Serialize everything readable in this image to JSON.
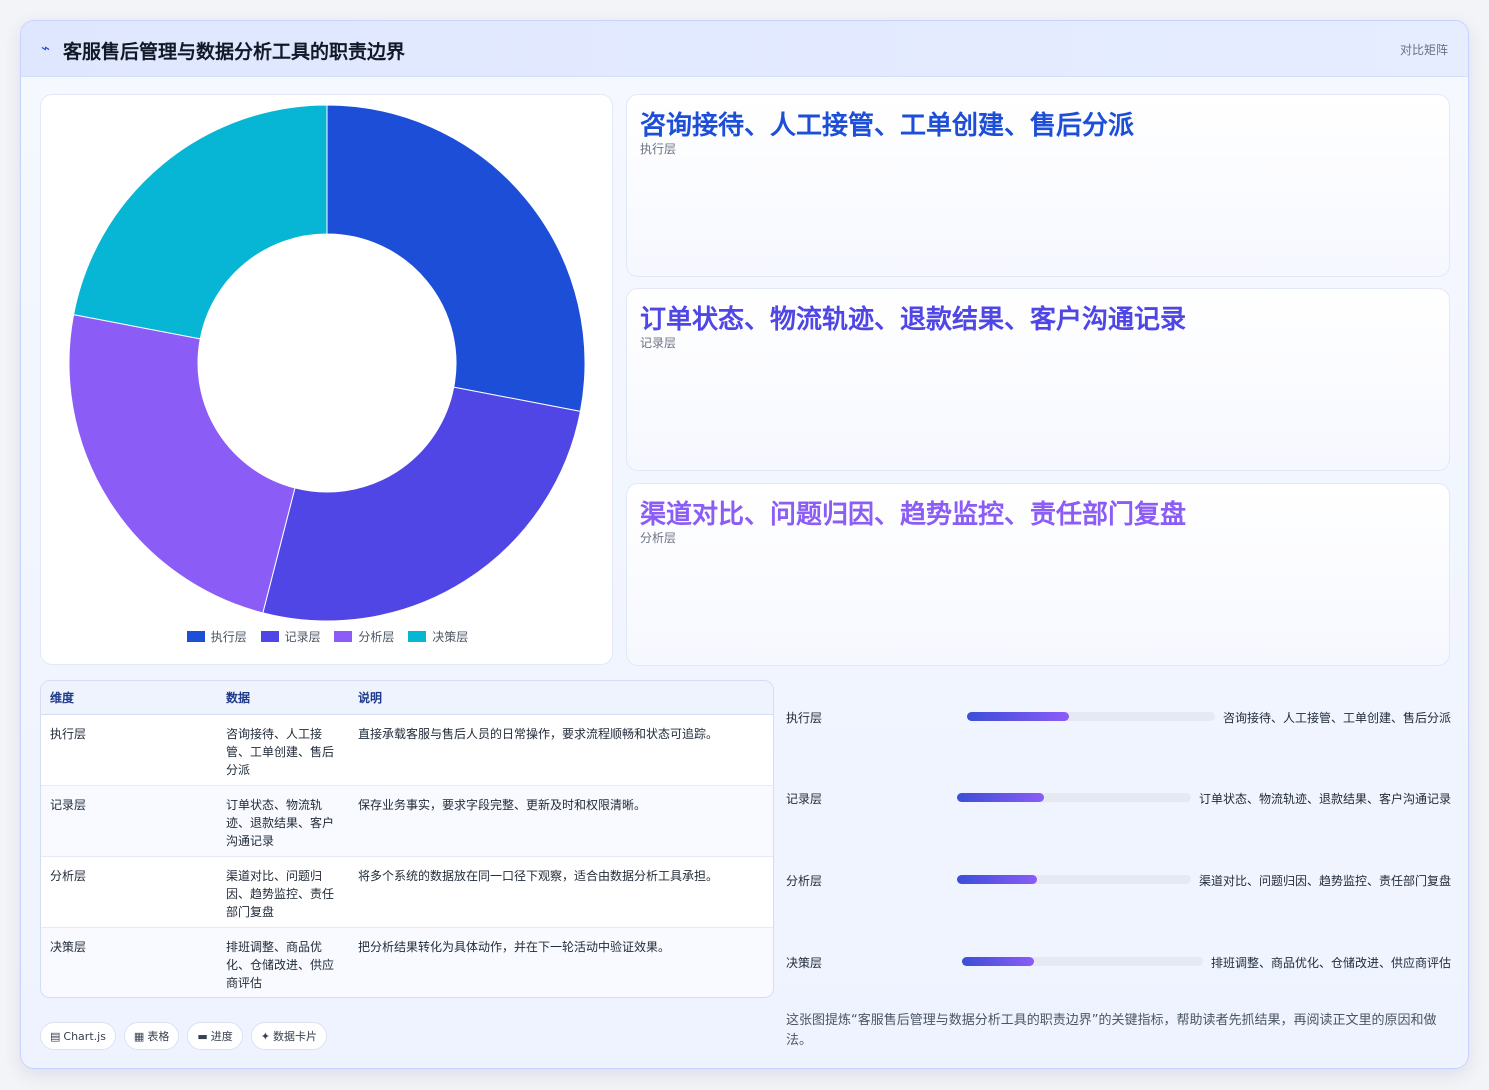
{
  "header": {
    "icon": "chart-line-icon",
    "title": "客服售后管理与数据分析工具的职责边界",
    "tag": "对比矩阵"
  },
  "stats": [
    {
      "value": "咨询接待、人工接管、工单创建、售后分派",
      "label": "执行层",
      "color": "#1d4ed8"
    },
    {
      "value": "订单状态、物流轨迹、退款结果、客户沟通记录",
      "label": "记录层",
      "color": "#4f46e5"
    },
    {
      "value": "渠道对比、问题归因、趋势监控、责任部门复盘",
      "label": "分析层",
      "color": "#8b5cf6"
    }
  ],
  "chart_data": {
    "type": "pie",
    "donut": true,
    "categories": [
      "执行层",
      "记录层",
      "分析层",
      "决策层"
    ],
    "values": [
      28,
      26,
      24,
      22
    ],
    "colors": [
      "#1d4ed8",
      "#4f46e5",
      "#8b5cf6",
      "#06b6d4"
    ],
    "legend": "bottom"
  },
  "table": {
    "headers": [
      "维度",
      "数据",
      "说明"
    ],
    "rows": [
      {
        "dim": "执行层",
        "data": "咨询接待、人工接管、工单创建、售后分派",
        "desc": "直接承载客服与售后人员的日常操作，要求流程顺畅和状态可追踪。"
      },
      {
        "dim": "记录层",
        "data": "订单状态、物流轨迹、退款结果、客户沟通记录",
        "desc": "保存业务事实，要求字段完整、更新及时和权限清晰。"
      },
      {
        "dim": "分析层",
        "data": "渠道对比、问题归因、趋势监控、责任部门复盘",
        "desc": "将多个系统的数据放在同一口径下观察，适合由数据分析工具承担。"
      },
      {
        "dim": "决策层",
        "data": "排班调整、商品优化、仓储改进、供应商评估",
        "desc": "把分析结果转化为具体动作，并在下一轮活动中验证效果。"
      }
    ]
  },
  "progress": [
    {
      "label": "执行层",
      "text": "咨询接待、人工接管、工单创建、售后分派",
      "fraction": 0.41
    },
    {
      "label": "记录层",
      "text": "订单状态、物流轨迹、退款结果、客户沟通记录",
      "fraction": 0.37
    },
    {
      "label": "分析层",
      "text": "渠道对比、问题归因、趋势监控、责任部门复盘",
      "fraction": 0.34
    },
    {
      "label": "决策层",
      "text": "排班调整、商品优化、仓储改进、供应商评估",
      "fraction": 0.3
    }
  ],
  "note": "这张图提炼“客服售后管理与数据分析工具的职责边界”的关键指标，帮助读者先抓结果，再阅读正文里的原因和做法。",
  "chips": [
    {
      "icon": "chart-icon",
      "label": "Chart.js"
    },
    {
      "icon": "table-icon",
      "label": "表格"
    },
    {
      "icon": "progress-icon",
      "label": "进度"
    },
    {
      "icon": "sparkle-icon",
      "label": "数据卡片"
    }
  ]
}
